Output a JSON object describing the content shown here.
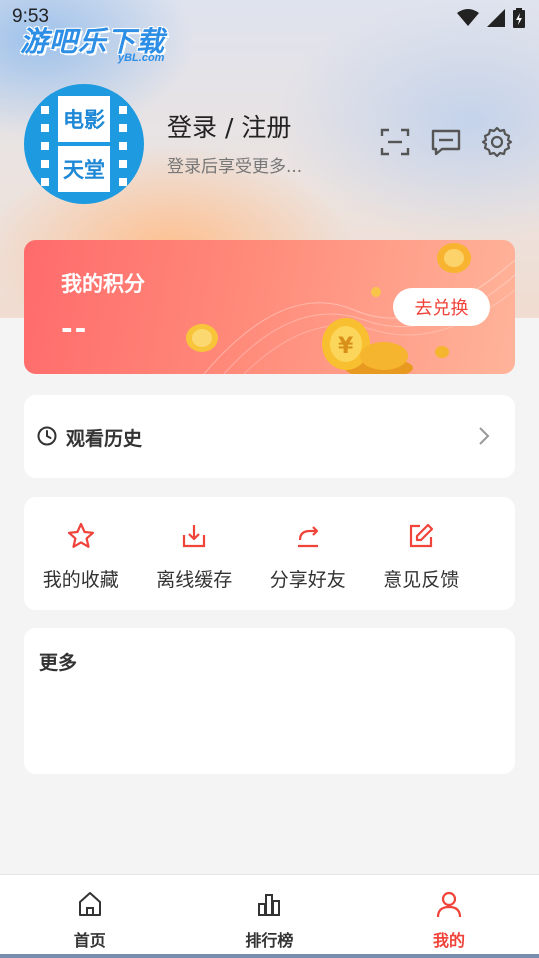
{
  "status_bar": {
    "time": "9:53"
  },
  "watermark": {
    "text": "游吧乐下载",
    "sub": "yBL.com"
  },
  "profile": {
    "avatar_top": "电影",
    "avatar_bottom": "天堂",
    "login_title": "登录 / 注册",
    "login_subtitle": "登录后享受更多..."
  },
  "header_icons": [
    "scan-icon",
    "message-icon",
    "settings-icon"
  ],
  "points": {
    "title": "我的积分",
    "value": "--",
    "redeem_label": "去兑换"
  },
  "history": {
    "label": "观看历史"
  },
  "actions": [
    {
      "label": "我的收藏",
      "icon": "star-icon"
    },
    {
      "label": "离线缓存",
      "icon": "download-icon"
    },
    {
      "label": "分享好友",
      "icon": "share-icon"
    },
    {
      "label": "意见反馈",
      "icon": "feedback-icon"
    }
  ],
  "more": {
    "title": "更多"
  },
  "nav": [
    {
      "label": "首页",
      "icon": "home-icon",
      "active": false
    },
    {
      "label": "排行榜",
      "icon": "ranking-icon",
      "active": false
    },
    {
      "label": "我的",
      "icon": "profile-icon",
      "active": true
    }
  ],
  "colors": {
    "accent": "#f0433a",
    "avatar_blue": "#1e9ae0"
  }
}
